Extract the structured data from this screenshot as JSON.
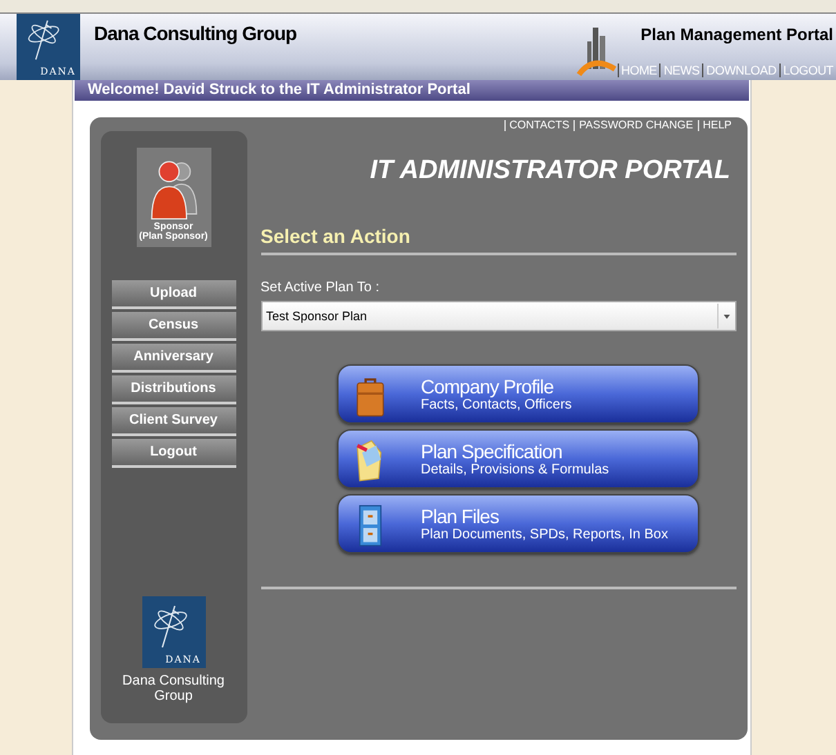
{
  "header": {
    "company": "Dana Consulting Group",
    "logo_text": "DANA",
    "portal_title": "Plan Management Portal",
    "nav": [
      "HOME",
      "NEWS",
      "DOWNLOAD",
      "LOGOUT"
    ]
  },
  "welcome": "Welcome! David Struck to the IT Administrator Portal",
  "top_links": [
    "CONTACTS",
    "PASSWORD CHANGE",
    "HELP"
  ],
  "sidebar": {
    "role": "Sponsor",
    "role_detail": "(Plan Sponsor)",
    "menu": [
      "Upload",
      "Census",
      "Anniversary",
      "Distributions",
      "Client Survey",
      "Logout"
    ],
    "logo_text": "DANA",
    "company": "Dana Consulting Group"
  },
  "main": {
    "title": "IT ADMINISTRATOR PORTAL",
    "section": "Select an Action",
    "plan_label": "Set Active Plan To :",
    "plan_value": "Test Sponsor Plan",
    "actions": [
      {
        "kind": "briefcase",
        "title": "Company Profile",
        "subtitle": "Facts, Contacts, Officers"
      },
      {
        "kind": "folder",
        "title": "Plan Specification",
        "subtitle": "Details, Provisions & Formulas"
      },
      {
        "kind": "cabinet",
        "title": "Plan Files",
        "subtitle": "Plan Documents, SPDs, Reports, In Box"
      }
    ]
  }
}
